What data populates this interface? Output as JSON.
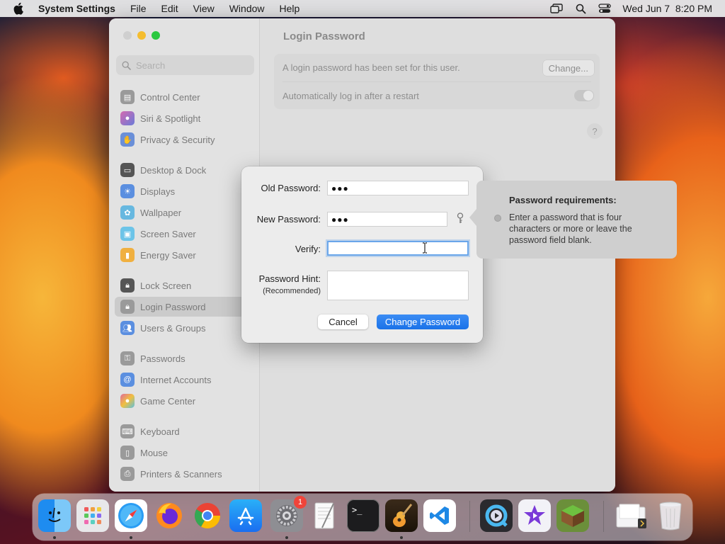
{
  "menubar": {
    "app_name": "System Settings",
    "menus": [
      "File",
      "Edit",
      "View",
      "Window",
      "Help"
    ],
    "datetime": "Wed Jun 7  8:20 PM"
  },
  "sidebar": {
    "search_placeholder": "Search",
    "items": [
      {
        "label": "Control Center",
        "icon": "control-center-icon",
        "color": "#9a9a9a"
      },
      {
        "label": "Siri & Spotlight",
        "icon": "siri-icon",
        "color": "#b06ab8"
      },
      {
        "label": "Privacy & Security",
        "icon": "hand-icon",
        "color": "#6a8fd8"
      },
      {
        "label": "Desktop & Dock",
        "icon": "dock-icon",
        "color": "#555555"
      },
      {
        "label": "Displays",
        "icon": "sun-icon",
        "color": "#5b8fe0"
      },
      {
        "label": "Wallpaper",
        "icon": "wallpaper-icon",
        "color": "#67b8e0"
      },
      {
        "label": "Screen Saver",
        "icon": "screen-saver-icon",
        "color": "#6cc4e8"
      },
      {
        "label": "Energy Saver",
        "icon": "battery-icon",
        "color": "#f0b040"
      },
      {
        "label": "Lock Screen",
        "icon": "lock-icon",
        "color": "#555555"
      },
      {
        "label": "Login Password",
        "icon": "lock-icon",
        "color": "#9a9a9a"
      },
      {
        "label": "Users & Groups",
        "icon": "users-icon",
        "color": "#5b8fe0"
      },
      {
        "label": "Passwords",
        "icon": "key-icon",
        "color": "#9a9a9a"
      },
      {
        "label": "Internet Accounts",
        "icon": "at-icon",
        "color": "#5b8fe0"
      },
      {
        "label": "Game Center",
        "icon": "game-center-icon",
        "color": "#e06a9a"
      },
      {
        "label": "Keyboard",
        "icon": "keyboard-icon",
        "color": "#9a9a9a"
      },
      {
        "label": "Mouse",
        "icon": "mouse-icon",
        "color": "#9a9a9a"
      },
      {
        "label": "Printers & Scanners",
        "icon": "printer-icon",
        "color": "#9a9a9a"
      }
    ]
  },
  "content": {
    "title": "Login Password",
    "password_set_text": "A login password has been set for this user.",
    "change_button": "Change...",
    "auto_login_label": "Automatically log in after a restart",
    "auto_login_enabled": false,
    "help": "?"
  },
  "dialog": {
    "old_password_label": "Old Password:",
    "old_password_value": "●●●",
    "new_password_label": "New Password:",
    "new_password_value": "●●●",
    "verify_label": "Verify:",
    "verify_value": "",
    "hint_label": "Password Hint:",
    "hint_sublabel": "(Recommended)",
    "hint_value": "",
    "cancel_button": "Cancel",
    "change_button": "Change Password"
  },
  "tooltip": {
    "title": "Password requirements:",
    "text": "Enter a password that is four characters or more or leave the password field blank."
  },
  "dock": {
    "apps": [
      "Finder",
      "Launchpad",
      "Safari",
      "Firefox",
      "Chrome",
      "App Store",
      "System Settings",
      "TextEdit",
      "Terminal",
      "GarageBand",
      "Visual Studio Code",
      "QuickTime Player",
      "iMovie",
      "Minecraft",
      "Downloads",
      "Trash"
    ],
    "system_settings_badge": "1"
  }
}
